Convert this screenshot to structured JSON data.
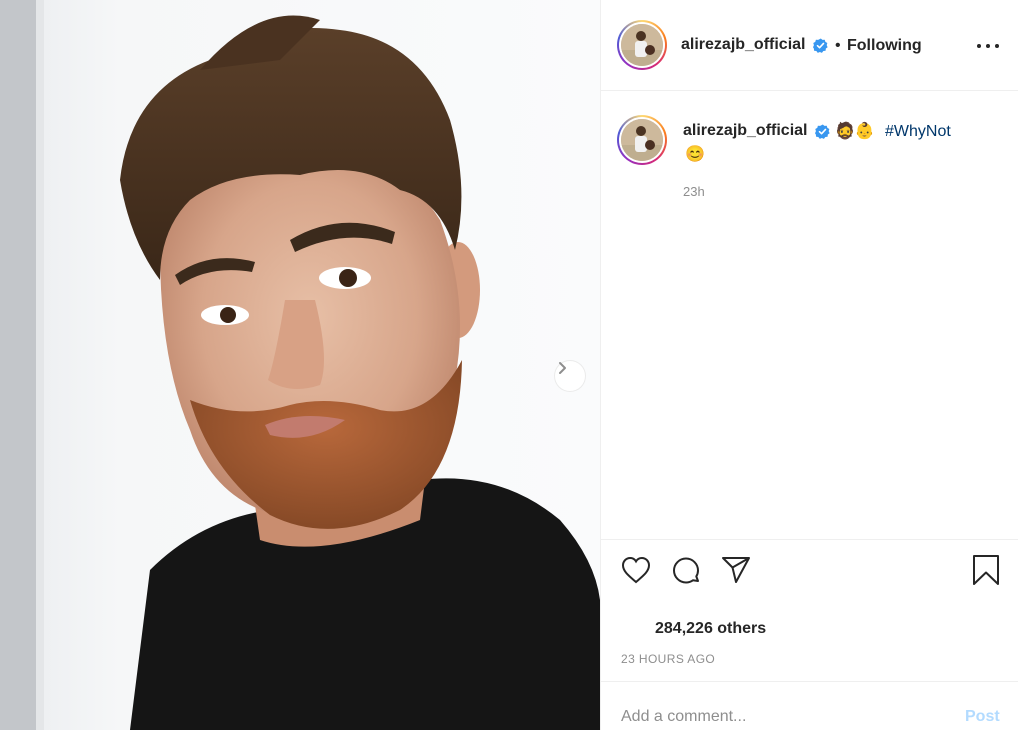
{
  "post": {
    "username": "alirezajb_official",
    "verified": true,
    "follow_status": "Following",
    "separator": "•",
    "caption_emojis": "🧔👶",
    "caption_hashtag": "#WhyNot",
    "caption_emoji_2": "😊",
    "caption_age": "23h",
    "likes_text": "284,226 others",
    "timestamp": "23 HOURS AGO"
  },
  "comment": {
    "placeholder": "Add a comment...",
    "post_label": "Post"
  },
  "icons": {
    "more": "more-options-icon",
    "like": "heart-icon",
    "comment": "comment-icon",
    "share": "share-icon",
    "save": "bookmark-icon",
    "next": "chevron-right-icon",
    "verified": "verified-badge-icon"
  },
  "colors": {
    "verified_blue": "#3897f0",
    "hashtag": "#00376b",
    "post_button_disabled": "#b3dbff",
    "muted_text": "#8e8e8e"
  }
}
